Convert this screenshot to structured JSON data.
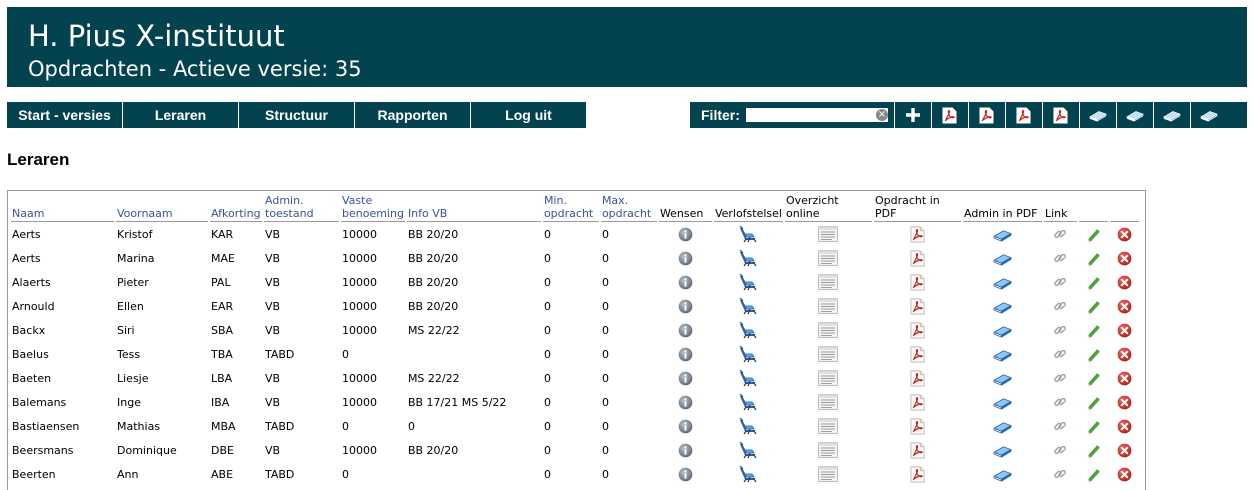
{
  "header": {
    "school": "H. Pius X-instituut",
    "subtitle": "Opdrachten - Actieve versie: 35"
  },
  "menu": [
    {
      "label": "Start - versies"
    },
    {
      "label": "Leraren"
    },
    {
      "label": "Structuur"
    },
    {
      "label": "Rapporten"
    },
    {
      "label": "Log uit"
    }
  ],
  "filter": {
    "label": "Filter:",
    "value": ""
  },
  "toolbar": {
    "icons": [
      "plus-icon",
      "pdf-icon",
      "pdf-icon",
      "pdf-icon",
      "pdf-icon",
      "book-icon",
      "book-icon",
      "book-icon",
      "book-icon"
    ]
  },
  "section_title": "Leraren",
  "table": {
    "columns": [
      {
        "label": "Naam",
        "sort": true
      },
      {
        "label": "Voornaam",
        "sort": true
      },
      {
        "label": "Afkorting",
        "sort": true
      },
      {
        "label": "Admin. toestand",
        "sort": true
      },
      {
        "label": "Vaste benoeming",
        "sort": true
      },
      {
        "label": "Info VB",
        "sort": true
      },
      {
        "label": "Min. opdracht",
        "sort": true
      },
      {
        "label": "Max. opdracht",
        "sort": true
      },
      {
        "label": "Wensen",
        "sort": false
      },
      {
        "label": "Verlofstelsel",
        "sort": false
      },
      {
        "label": "Overzicht online",
        "sort": false
      },
      {
        "label": "Opdracht in PDF",
        "sort": false
      },
      {
        "label": "Admin in PDF",
        "sort": false
      },
      {
        "label": "Link",
        "sort": false
      },
      {
        "label": "",
        "sort": false
      },
      {
        "label": "",
        "sort": false
      }
    ],
    "rows": [
      [
        "Aerts",
        "Kristof",
        "KAR",
        "VB",
        "10000",
        "BB 20/20",
        "0",
        "0"
      ],
      [
        "Aerts",
        "Marina",
        "MAE",
        "VB",
        "10000",
        "BB 20/20",
        "0",
        "0"
      ],
      [
        "Alaerts",
        "Pieter",
        "PAL",
        "VB",
        "10000",
        "BB 20/20",
        "0",
        "0"
      ],
      [
        "Arnould",
        "Ellen",
        "EAR",
        "VB",
        "10000",
        "BB 20/20",
        "0",
        "0"
      ],
      [
        "Backx",
        "Siri",
        "SBA",
        "VB",
        "10000",
        "MS 22/22",
        "0",
        "0"
      ],
      [
        "Baelus",
        "Tess",
        "TBA",
        "TABD",
        "0",
        "",
        "0",
        "0"
      ],
      [
        "Baeten",
        "Liesje",
        "LBA",
        "VB",
        "10000",
        "MS 22/22",
        "0",
        "0"
      ],
      [
        "Balemans",
        "Inge",
        "IBA",
        "VB",
        "10000",
        "BB 17/21 MS 5/22",
        "0",
        "0"
      ],
      [
        "Bastiaensen",
        "Mathias",
        "MBA",
        "TABD",
        "0",
        "0",
        "0",
        "0"
      ],
      [
        "Beersmans",
        "Dominique",
        "DBE",
        "VB",
        "10000",
        "BB 20/20",
        "0",
        "0"
      ],
      [
        "Beerten",
        "Ann",
        "ABE",
        "TABD",
        "0",
        "",
        "0",
        "0"
      ]
    ]
  }
}
